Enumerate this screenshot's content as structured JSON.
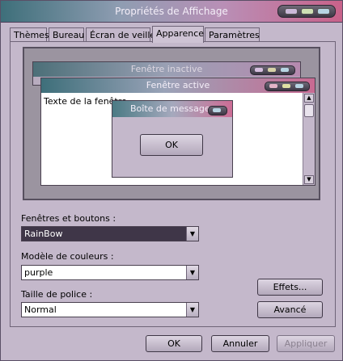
{
  "window": {
    "title": "Propriétés de Affichage"
  },
  "tabs": [
    {
      "label": "Thèmes"
    },
    {
      "label": "Bureau"
    },
    {
      "label": "Écran de veille"
    },
    {
      "label": "Apparence",
      "active": true
    },
    {
      "label": "Paramètres"
    }
  ],
  "preview": {
    "inactive_title": "Fenêtre inactive",
    "active_title": "Fenêtre active",
    "window_text": "Texte de la fenêtre",
    "message_title": "Boîte de message",
    "ok_label": "OK"
  },
  "settings": {
    "windows_buttons_label": "Fenêtres et boutons :",
    "windows_buttons_value": "RainBow",
    "color_scheme_label": "Modèle de couleurs :",
    "color_scheme_value": "purple",
    "font_size_label": "Taille de police :",
    "font_size_value": "Normal",
    "effects_label": "Effets...",
    "advanced_label": "Avancé"
  },
  "footer": {
    "ok_label": "OK",
    "cancel_label": "Annuler",
    "apply_label": "Appliquer"
  },
  "colors": {
    "window_bg": "#c4b8cb",
    "title_gradient_start": "#3e6f7a",
    "title_gradient_end": "#c8628a",
    "dropdown_selected_bg": "#3f3648"
  }
}
